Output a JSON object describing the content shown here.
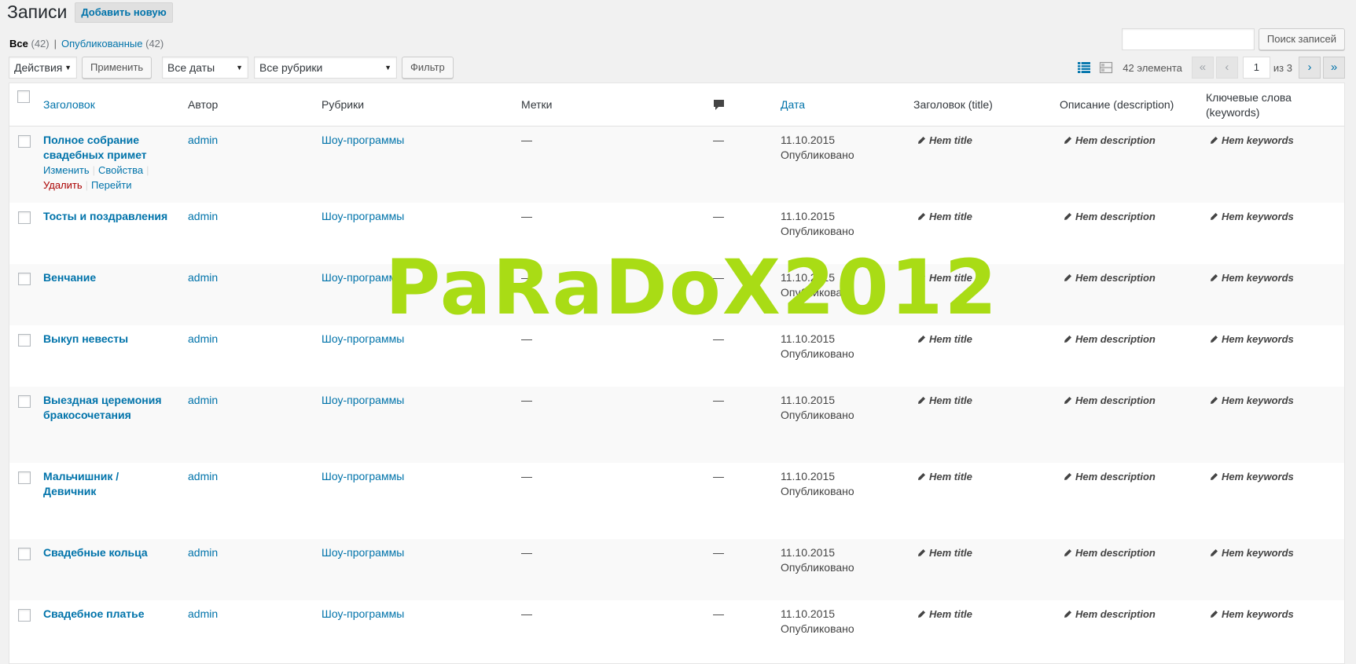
{
  "header": {
    "title": "Записи",
    "add_new": "Добавить новую"
  },
  "filters": {
    "all_label": "Все",
    "all_count": "(42)",
    "sep": "|",
    "published_label": "Опубликованные",
    "published_count": "(42)"
  },
  "search": {
    "button": "Поиск записей",
    "value": ""
  },
  "tablenav": {
    "bulk_actions": "Действия",
    "apply": "Применить",
    "dates": "Все даты",
    "categories": "Все рубрики",
    "filter": "Фильтр",
    "items_count": "42 элемента",
    "first": "«",
    "prev": "‹",
    "current_page": "1",
    "of": "из 3",
    "next": "›",
    "last": "»"
  },
  "columns": {
    "title": "Заголовок",
    "author": "Автор",
    "categories": "Рубрики",
    "tags": "Метки",
    "date": "Дата",
    "seo_title": "Заголовок (title)",
    "seo_description": "Описание (description)",
    "seo_keywords_1": "Ключевые слова",
    "seo_keywords_2": "(keywords)"
  },
  "row_actions": {
    "edit": "Изменить",
    "properties": "Свойства",
    "delete": "Удалить",
    "view": "Перейти"
  },
  "rows": [
    {
      "title_1": "Полное собрание",
      "title_2": "свадебных примет",
      "author": "admin",
      "category": "Шоу-программы",
      "tags": "—",
      "comments": "—",
      "date": "11.10.2015",
      "status": "Опубликовано",
      "seo_title": "Нет title",
      "seo_description": "Нет description",
      "seo_keywords": "Нет keywords"
    },
    {
      "title_1": "Тосты и поздравления",
      "title_2": "",
      "author": "admin",
      "category": "Шоу-программы",
      "tags": "—",
      "comments": "—",
      "date": "11.10.2015",
      "status": "Опубликовано",
      "seo_title": "Нет title",
      "seo_description": "Нет description",
      "seo_keywords": "Нет keywords"
    },
    {
      "title_1": "Венчание",
      "title_2": "",
      "author": "admin",
      "category": "Шоу-программы",
      "tags": "—",
      "comments": "—",
      "date": "11.10.2015",
      "status": "Опубликовано",
      "seo_title": "Нет title",
      "seo_description": "Нет description",
      "seo_keywords": "Нет keywords"
    },
    {
      "title_1": "Выкуп невесты",
      "title_2": "",
      "author": "admin",
      "category": "Шоу-программы",
      "tags": "—",
      "comments": "—",
      "date": "11.10.2015",
      "status": "Опубликовано",
      "seo_title": "Нет title",
      "seo_description": "Нет description",
      "seo_keywords": "Нет keywords"
    },
    {
      "title_1": "Выездная церемония",
      "title_2": "бракосочетания",
      "author": "admin",
      "category": "Шоу-программы",
      "tags": "—",
      "comments": "—",
      "date": "11.10.2015",
      "status": "Опубликовано",
      "seo_title": "Нет title",
      "seo_description": "Нет description",
      "seo_keywords": "Нет keywords"
    },
    {
      "title_1": "Мальчишник /",
      "title_2": "Девичник",
      "author": "admin",
      "category": "Шоу-программы",
      "tags": "—",
      "comments": "—",
      "date": "11.10.2015",
      "status": "Опубликовано",
      "seo_title": "Нет title",
      "seo_description": "Нет description",
      "seo_keywords": "Нет keywords"
    },
    {
      "title_1": "Свадебные кольца",
      "title_2": "",
      "author": "admin",
      "category": "Шоу-программы",
      "tags": "—",
      "comments": "—",
      "date": "11.10.2015",
      "status": "Опубликовано",
      "seo_title": "Нет title",
      "seo_description": "Нет description",
      "seo_keywords": "Нет keywords"
    },
    {
      "title_1": "Свадебное платье",
      "title_2": "",
      "author": "admin",
      "category": "Шоу-программы",
      "tags": "—",
      "comments": "—",
      "date": "11.10.2015",
      "status": "Опубликовано",
      "seo_title": "Нет title",
      "seo_description": "Нет description",
      "seo_keywords": "Нет keywords"
    }
  ],
  "watermark": "PaRaDoX2012",
  "colors": {
    "link": "#0073aa",
    "delete": "#aa0000",
    "watermark": "#a9dc15"
  },
  "icons": {
    "comments_header": "comment-bubble-icon",
    "seo_cell": "pencil-icon",
    "view_list": "list-view-icon",
    "view_excerpt": "excerpt-view-icon"
  }
}
